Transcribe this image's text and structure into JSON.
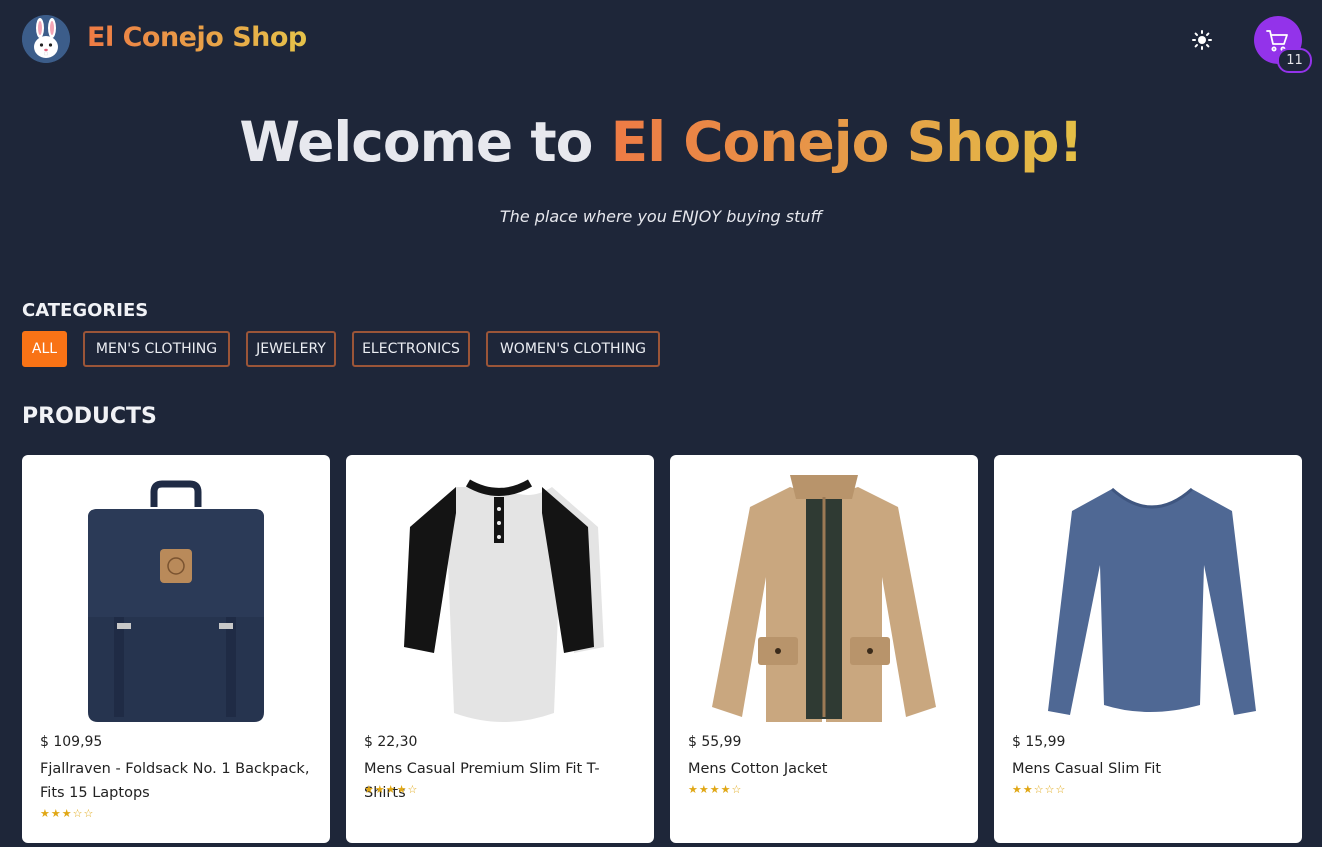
{
  "header": {
    "brand": "El Conejo Shop",
    "cart_count": "11"
  },
  "hero": {
    "title_prefix": "Welcome to",
    "title_brand": "El Conejo Shop!",
    "subtitle": "The place where you ENJOY buying stuff"
  },
  "categories": {
    "title": "CATEGORIES",
    "items": [
      {
        "label": "ALL",
        "active": true
      },
      {
        "label": "MEN'S CLOTHING",
        "active": false
      },
      {
        "label": "JEWELERY",
        "active": false
      },
      {
        "label": "ELECTRONICS",
        "active": false
      },
      {
        "label": "WOMEN'S CLOTHING",
        "active": false
      }
    ]
  },
  "products": {
    "title": "PRODUCTS",
    "items": [
      {
        "price": "$ 109,95",
        "name": "Fjallraven - Foldsack No. 1 Backpack, Fits 15 Laptops",
        "stars": "★★★☆☆",
        "rating": 3
      },
      {
        "price": "$ 22,30",
        "name": "Mens Casual Premium Slim Fit T-Shirts",
        "stars": "★★★★☆",
        "rating": 4
      },
      {
        "price": "$ 55,99",
        "name": "Mens Cotton Jacket",
        "stars": "★★★★☆",
        "rating": 4
      },
      {
        "price": "$ 15,99",
        "name": "Mens Casual Slim Fit",
        "stars": "★★☆☆☆",
        "rating": 2
      }
    ]
  },
  "colors": {
    "background": "#1e2639",
    "accent": "#f97316",
    "cart": "#9333ea",
    "star": "#e0a715"
  },
  "icons": {
    "logo": "rabbit-logo-icon",
    "theme": "sun-icon",
    "cart": "shopping-cart-icon"
  }
}
